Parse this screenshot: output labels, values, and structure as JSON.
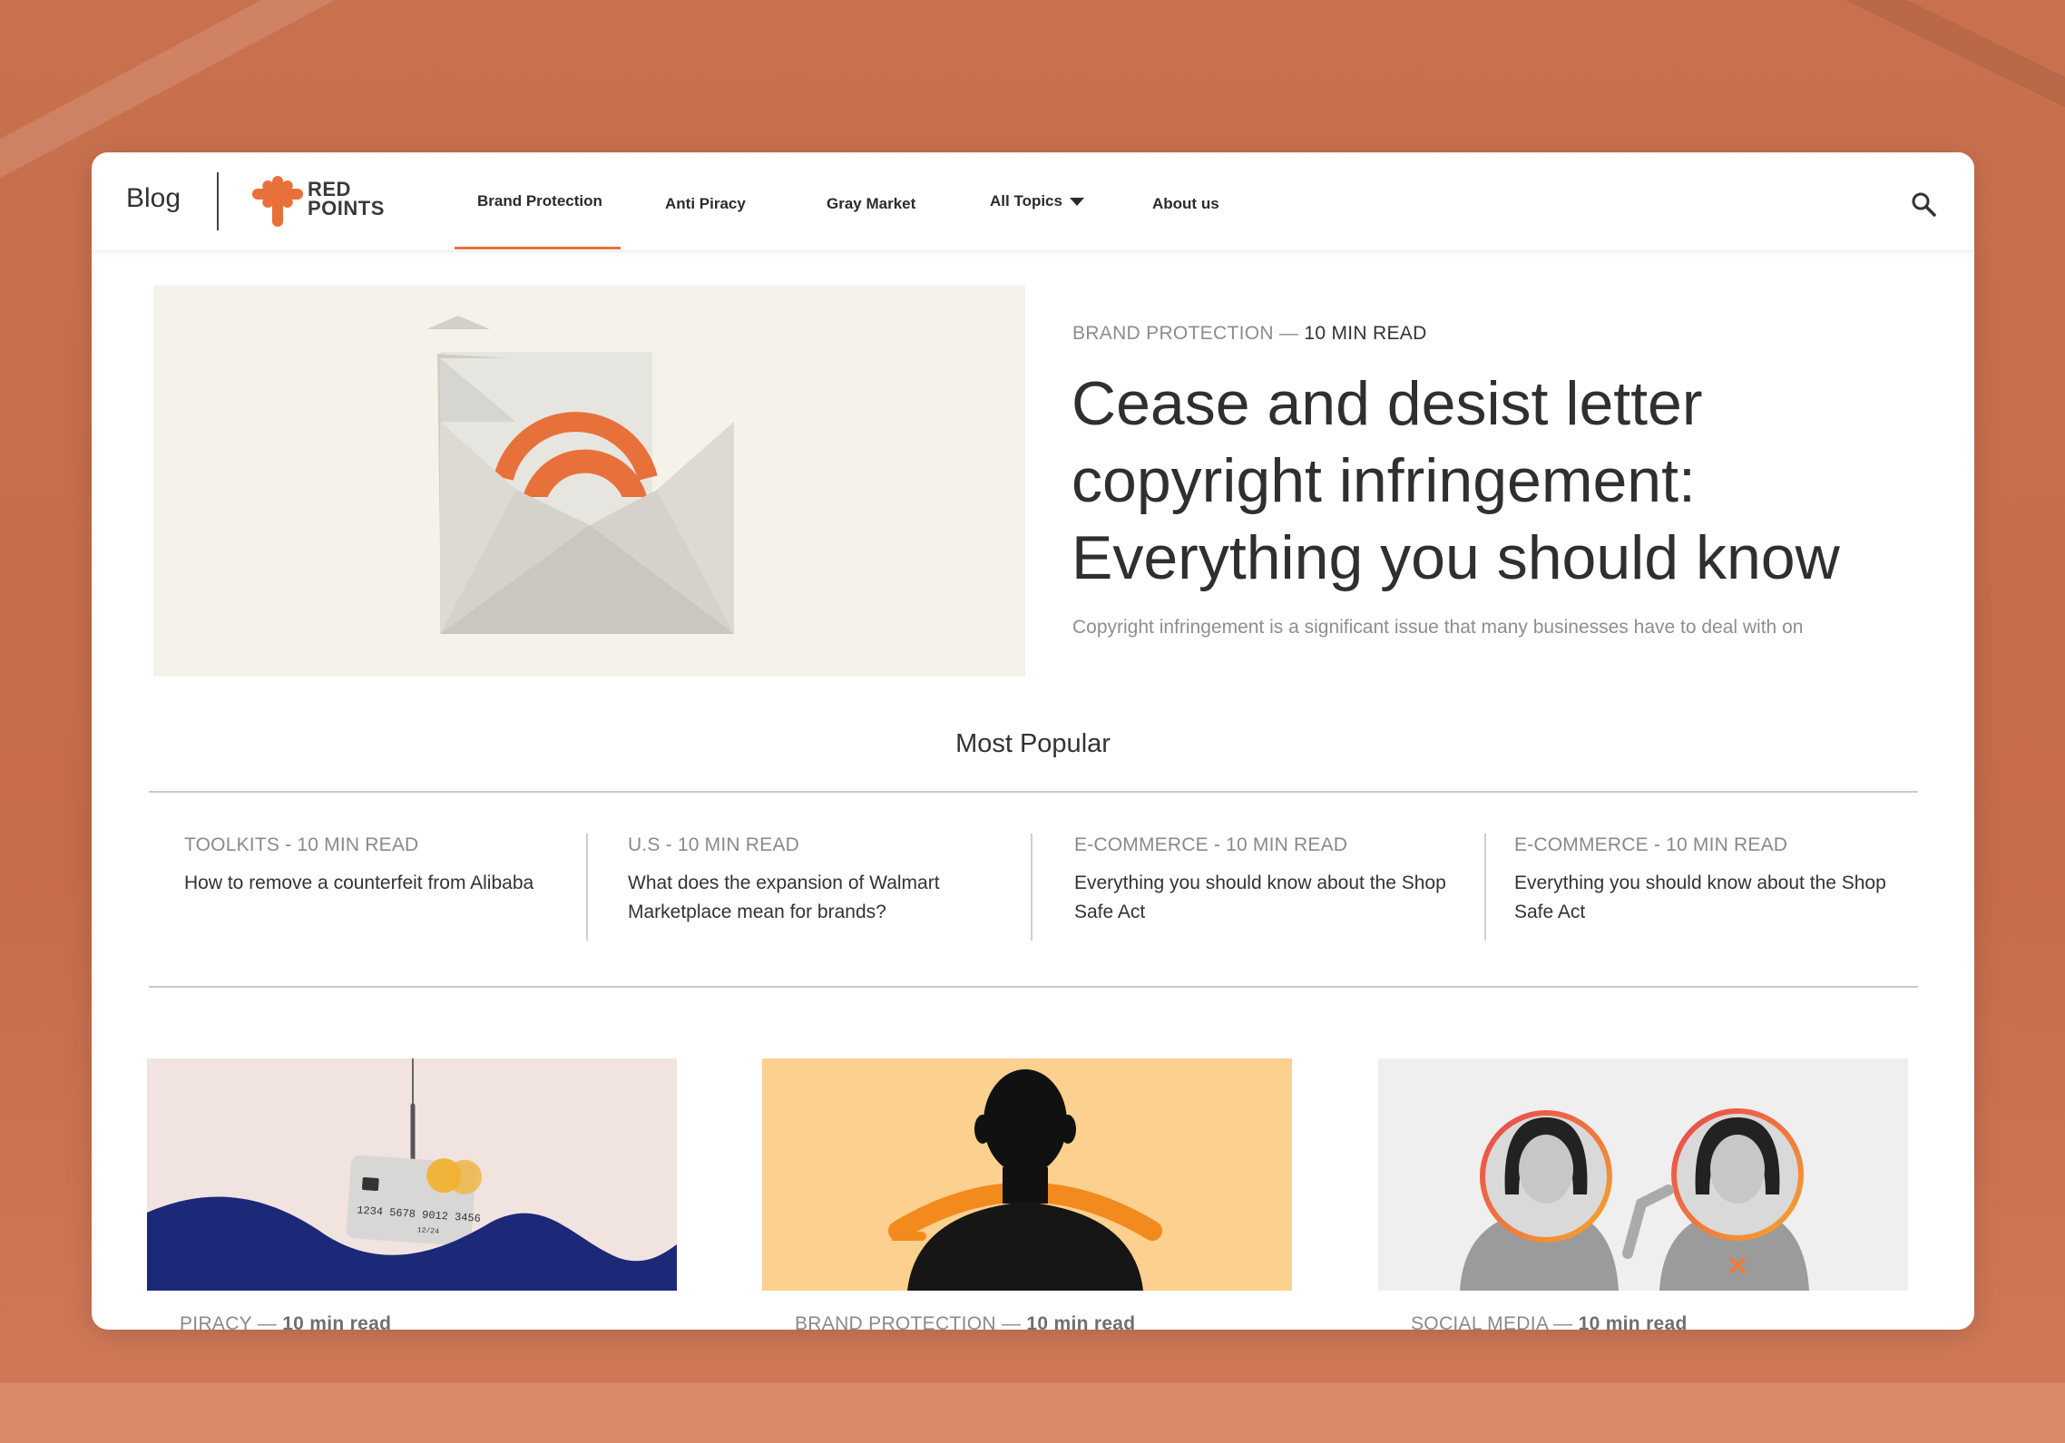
{
  "header": {
    "blog_label": "Blog",
    "logo_line1": "RED",
    "logo_line2": "POINTS",
    "nav": [
      {
        "label": "Brand Protection"
      },
      {
        "label": "Anti Piracy"
      },
      {
        "label": "Gray Market"
      },
      {
        "label": "All Topics"
      },
      {
        "label": "About us"
      }
    ]
  },
  "hero": {
    "category": "BRAND PROTECTION — ",
    "read_time": "10 MIN READ",
    "title": "Cease and desist letter copyright infringement: Everything you should know",
    "excerpt": "Copyright infringement is a significant issue that many businesses have to deal with on"
  },
  "most_popular": {
    "title": "Most Popular",
    "items": [
      {
        "category": "TOOLKITS - 10 MIN READ",
        "title": "How to remove a counterfeit from Alibaba"
      },
      {
        "category": "U.S - 10 MIN READ",
        "title": "What does the expansion of Walmart Marketplace mean for brands?"
      },
      {
        "category": "E-COMMERCE - 10 MIN READ",
        "title": "Everything you should know about the Shop Safe Act"
      },
      {
        "category": "E-COMMERCE - 10 MIN READ",
        "title": "Everything you should know about the Shop Safe Act"
      }
    ]
  },
  "cards": [
    {
      "category": "PIRACY — ",
      "read_time": "10 min read",
      "card_number": "1234 5678 9012 3456",
      "card_expiry": "12/24"
    },
    {
      "category": "BRAND PROTECTION — ",
      "read_time": "10 min read"
    },
    {
      "category": "SOCIAL MEDIA — ",
      "read_time": "10 min read"
    }
  ],
  "colors": {
    "accent": "#e8703a",
    "background": "#c56c4b",
    "navy_wave": "#1c2878",
    "amber_card": "#fcd08e"
  }
}
